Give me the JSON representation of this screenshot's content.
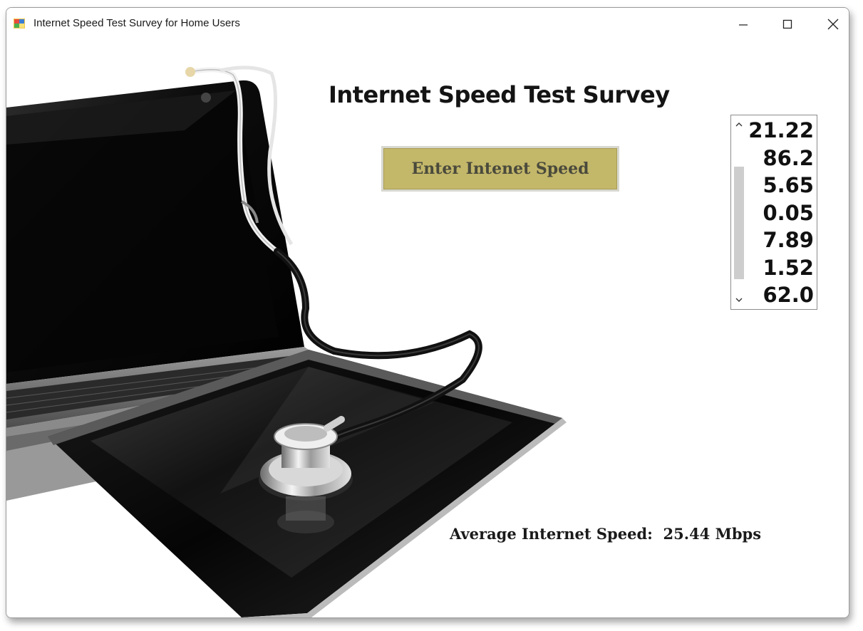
{
  "window": {
    "title": "Internet Speed Test Survey for Home Users"
  },
  "form": {
    "heading": "Internet Speed Test Survey",
    "enter_button_label": "Enter Intenet Speed",
    "speeds": [
      "21.22",
      "86.2",
      "5.65",
      "0.05",
      "7.89",
      "1.52",
      "62.0"
    ],
    "average_label": "Average Internet Speed:",
    "average_value": "25.44 Mbps"
  },
  "icons": {
    "app": "form-app-icon",
    "minimize": "minimize-icon",
    "maximize": "maximize-icon",
    "close": "close-icon",
    "scroll_up": "chevron-up-icon",
    "scroll_down": "chevron-down-icon"
  },
  "colors": {
    "button_fill": "#c3b76a",
    "button_text": "#4a4a3c"
  }
}
